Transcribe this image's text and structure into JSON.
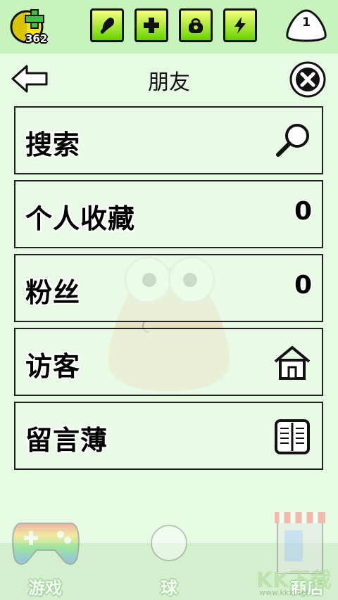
{
  "topbar": {
    "coins": "362",
    "stats": [
      {
        "name": "food",
        "icon": "drumstick-icon"
      },
      {
        "name": "health",
        "icon": "plus-icon"
      },
      {
        "name": "bag",
        "icon": "bag-icon"
      },
      {
        "name": "energy",
        "icon": "lightning-icon"
      }
    ],
    "level": "1",
    "accent": "#68d300"
  },
  "header": {
    "title": "朋友",
    "back_icon": "arrow-left-icon",
    "close_icon": "close-icon"
  },
  "menu": [
    {
      "label": "搜索",
      "icon": "search-icon"
    },
    {
      "label": "个人收藏",
      "count": "0"
    },
    {
      "label": "粉丝",
      "count": "0"
    },
    {
      "label": "访客",
      "icon": "house-icon"
    },
    {
      "label": "留言薄",
      "icon": "book-icon"
    }
  ],
  "bottom_nav": [
    {
      "label": "游戏",
      "icon": "gamepad-icon"
    },
    {
      "label": "球",
      "icon": "ball-icon"
    },
    {
      "label": "商店",
      "icon": "shop-icon"
    }
  ],
  "watermark": {
    "text": "KK下载",
    "url": "www.kkx.net"
  }
}
